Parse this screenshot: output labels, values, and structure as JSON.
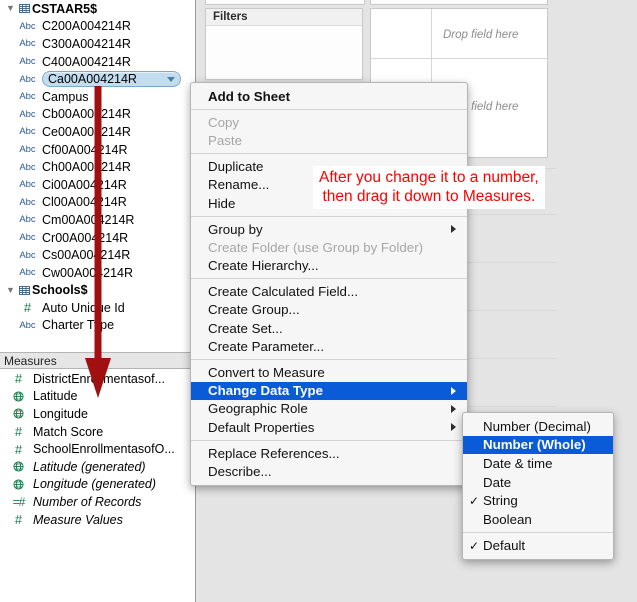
{
  "colors": {
    "menu_highlight": "#0a5bd8",
    "annotation_red": "#ff0000",
    "selection_pill": "#c2dcf0",
    "dimension_icon": "#2a5a9a",
    "measure_icon": "#1a7a4a"
  },
  "data_pane": {
    "tables": [
      {
        "name": "CSTAAR5$",
        "icon": "table-grid-icon",
        "expanded": true,
        "fields": [
          {
            "label": "C200A004214R",
            "type": "Abc",
            "selected": false
          },
          {
            "label": "C300A004214R",
            "type": "Abc",
            "selected": false
          },
          {
            "label": "C400A004214R",
            "type": "Abc",
            "selected": false
          },
          {
            "label": "Ca00A004214R",
            "type": "Abc",
            "selected": true
          },
          {
            "label": "Campus",
            "type": "Abc",
            "selected": false
          },
          {
            "label": "Cb00A004214R",
            "type": "Abc",
            "selected": false
          },
          {
            "label": "Ce00A004214R",
            "type": "Abc",
            "selected": false
          },
          {
            "label": "Cf00A004214R",
            "type": "Abc",
            "selected": false
          },
          {
            "label": "Ch00A004214R",
            "type": "Abc",
            "selected": false
          },
          {
            "label": "Ci00A004214R",
            "type": "Abc",
            "selected": false
          },
          {
            "label": "Cl00A004214R",
            "type": "Abc",
            "selected": false
          },
          {
            "label": "Cm00A004214R",
            "type": "Abc",
            "selected": false
          },
          {
            "label": "Cr00A004214R",
            "type": "Abc",
            "selected": false
          },
          {
            "label": "Cs00A004214R",
            "type": "Abc",
            "selected": false
          },
          {
            "label": "Cw00A004214R",
            "type": "Abc",
            "selected": false
          }
        ]
      },
      {
        "name": "Schools$",
        "icon": "table-grid-icon",
        "expanded": true,
        "fields": [
          {
            "label": "Auto Unique Id",
            "type": "hash",
            "selected": false
          },
          {
            "label": "Charter Type",
            "type": "Abc",
            "selected": false
          }
        ]
      }
    ],
    "measures_header": "Measures",
    "measures": [
      {
        "label": "DistrictEnrollmentasof...",
        "type": "hash",
        "italic": false
      },
      {
        "label": "Latitude",
        "type": "globe",
        "italic": false
      },
      {
        "label": "Longitude",
        "type": "globe",
        "italic": false
      },
      {
        "label": "Match Score",
        "type": "hash",
        "italic": false
      },
      {
        "label": "SchoolEnrollmentasofO...",
        "type": "hash",
        "italic": false
      },
      {
        "label": "Latitude (generated)",
        "type": "globe",
        "italic": true
      },
      {
        "label": "Longitude (generated)",
        "type": "globe",
        "italic": true
      },
      {
        "label": "Number of Records",
        "type": "records",
        "italic": true
      },
      {
        "label": "Measure Values",
        "type": "hash",
        "italic": true
      }
    ]
  },
  "worksheet": {
    "filters_title": "Filters",
    "drop_hint_1": "Drop field here",
    "drop_hint_2": "Drop field here"
  },
  "context_menu": {
    "items": [
      {
        "label": "Add to Sheet",
        "style": "bold",
        "submenu": false
      },
      {
        "type": "separator"
      },
      {
        "label": "Copy",
        "style": "disabled",
        "submenu": false
      },
      {
        "label": "Paste",
        "style": "disabled",
        "submenu": false
      },
      {
        "type": "separator"
      },
      {
        "label": "Duplicate",
        "style": "normal",
        "submenu": false
      },
      {
        "label": "Rename...",
        "style": "normal",
        "submenu": false
      },
      {
        "label": "Hide",
        "style": "normal",
        "submenu": false
      },
      {
        "type": "separator"
      },
      {
        "label": "Group by",
        "style": "normal",
        "submenu": true
      },
      {
        "label": "Create Folder (use Group by Folder)",
        "style": "disabled",
        "submenu": false
      },
      {
        "label": "Create Hierarchy...",
        "style": "normal",
        "submenu": false
      },
      {
        "type": "separator"
      },
      {
        "label": "Create Calculated Field...",
        "style": "normal",
        "submenu": false
      },
      {
        "label": "Create Group...",
        "style": "normal",
        "submenu": false
      },
      {
        "label": "Create Set...",
        "style": "normal",
        "submenu": false
      },
      {
        "label": "Create Parameter...",
        "style": "normal",
        "submenu": false
      },
      {
        "type": "separator"
      },
      {
        "label": "Convert to Measure",
        "style": "normal",
        "submenu": false
      },
      {
        "label": "Change Data Type",
        "style": "highlighted",
        "submenu": true
      },
      {
        "label": "Geographic Role",
        "style": "normal",
        "submenu": true
      },
      {
        "label": "Default Properties",
        "style": "normal",
        "submenu": true
      },
      {
        "type": "separator"
      },
      {
        "label": "Replace References...",
        "style": "normal",
        "submenu": false
      },
      {
        "label": "Describe...",
        "style": "normal",
        "submenu": false
      }
    ]
  },
  "submenu": {
    "title": "Change Data Type",
    "items": [
      {
        "label": "Number (Decimal)",
        "checked": false,
        "highlighted": false
      },
      {
        "label": "Number (Whole)",
        "checked": false,
        "highlighted": true
      },
      {
        "label": "Date & time",
        "checked": false,
        "highlighted": false
      },
      {
        "label": "Date",
        "checked": false,
        "highlighted": false
      },
      {
        "label": "String",
        "checked": true,
        "highlighted": false
      },
      {
        "label": "Boolean",
        "checked": false,
        "highlighted": false
      },
      {
        "type": "separator"
      },
      {
        "label": "Default",
        "checked": true,
        "highlighted": false
      }
    ]
  },
  "annotation": {
    "line1": "After you change it to a number,",
    "line2": "then drag it down to Measures."
  }
}
